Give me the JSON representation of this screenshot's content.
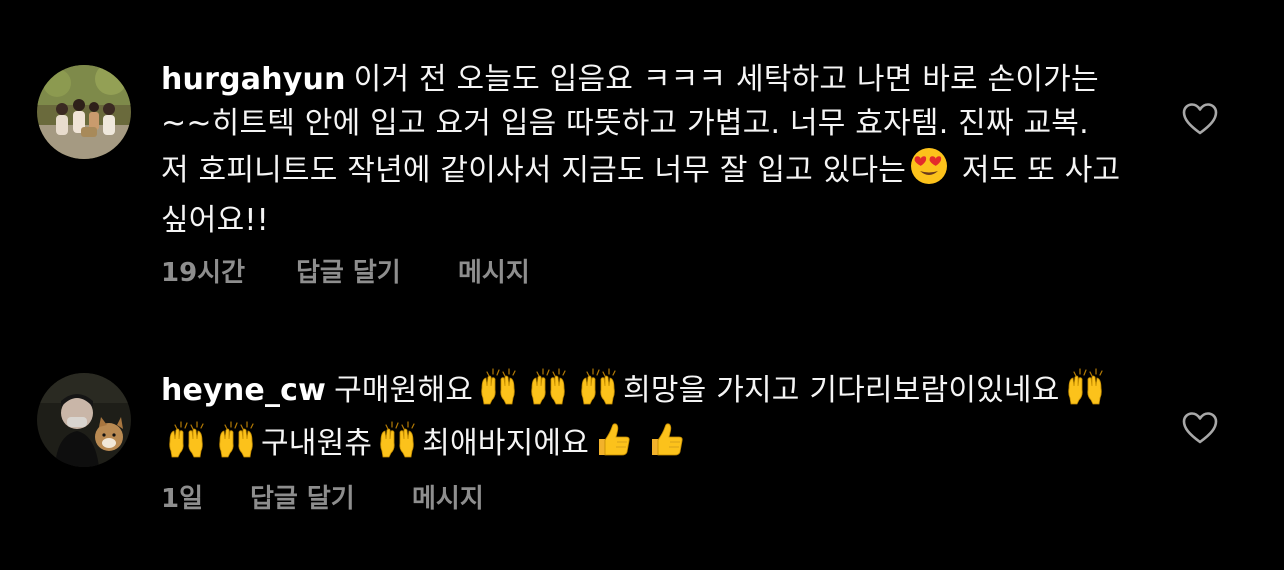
{
  "comments": [
    {
      "username": "hurgahyun",
      "text_part1": "이거 전 오늘도 입음요 ㅋㅋㅋ 세탁하고 나면 바로 손이가는~~히트텍 안에 입고 요거 입음 따뜻하고 가볍고. 너무 효자템. 진짜 교복. 저 호피니트도 작년에 같이사서 지금도 너무 잘 입고 있다는",
      "text_part2": " 저도 또 사고싶어요!!",
      "time": "19시간",
      "reply_label": "답글 달기",
      "message_label": "메시지"
    },
    {
      "username": "heyne_cw",
      "seg1": "구매원해요",
      "seg2": "희망을 가지고 기다리보람이있네요",
      "seg3": "구내원츄",
      "seg4": "최애바지에요",
      "time": "1일",
      "reply_label": "답글 달기",
      "message_label": "메시지"
    }
  ],
  "icons": {
    "heart": "heart-outline-icon",
    "emoji_love": "heart-eyes-emoji",
    "emoji_hands": "raising-hands-emoji",
    "emoji_thumbs": "thumbs-up-emoji"
  },
  "colors": {
    "background": "#000000",
    "text": "#f5f5f5",
    "meta": "#8e8e8e"
  }
}
